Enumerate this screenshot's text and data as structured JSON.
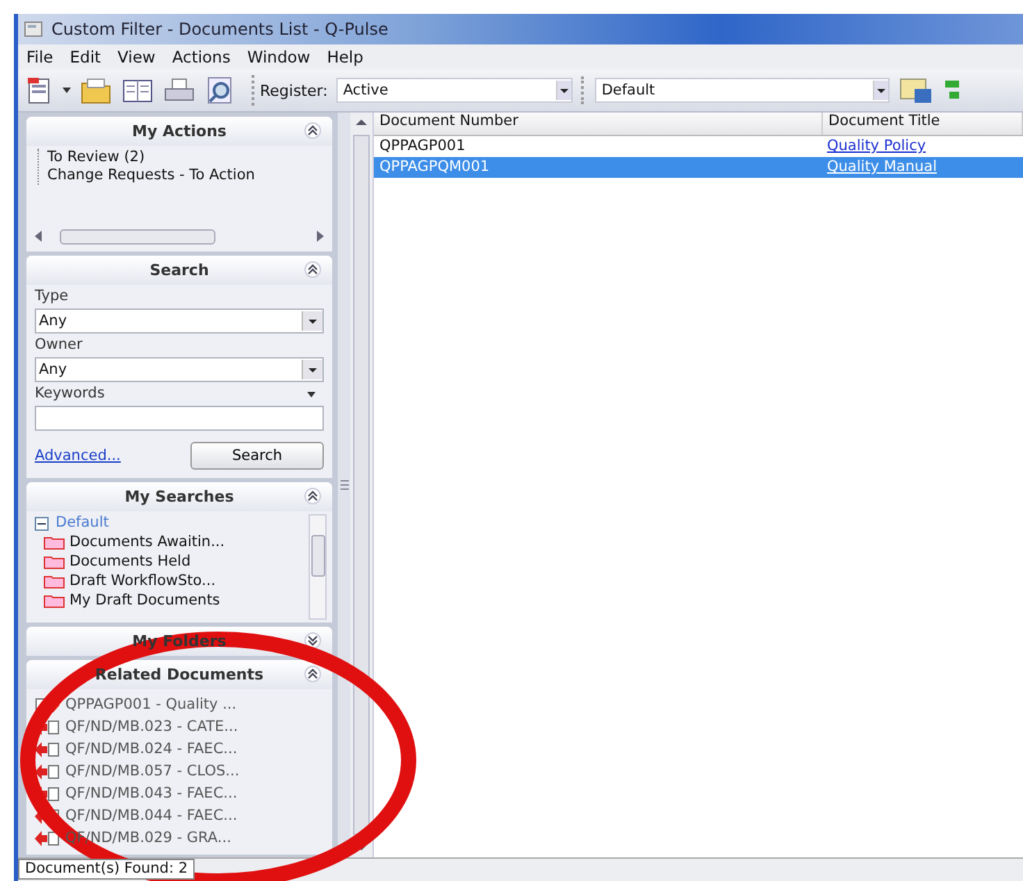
{
  "window": {
    "title": "Custom Filter - Documents List - Q-Pulse"
  },
  "menu": [
    "File",
    "Edit",
    "View",
    "Actions",
    "Window",
    "Help"
  ],
  "toolbar": {
    "register_label": "Register:",
    "register_value": "Active",
    "view_value": "Default"
  },
  "panels": [
    {
      "kind": "actions",
      "title": "My Actions",
      "expanded": true,
      "items": [
        "To Review (2)",
        "Change Requests - To Action"
      ]
    },
    {
      "kind": "search",
      "title": "Search",
      "expanded": true,
      "type_label": "Type",
      "type_value": "Any",
      "owner_label": "Owner",
      "owner_value": "Any",
      "keywords_label": "Keywords",
      "advanced_link": "Advanced...",
      "search_button": "Search"
    },
    {
      "kind": "searches",
      "title": "My Searches",
      "expanded": true,
      "root": {
        "label": "Default",
        "expanded": true,
        "children": [
          "Documents Awaitin...",
          "Documents Held",
          "Draft WorkflowSto...",
          "My Draft Documents"
        ]
      }
    },
    {
      "kind": "folders",
      "title": "My Folders",
      "expanded": false
    },
    {
      "kind": "related",
      "title": "Related Documents",
      "expanded": true,
      "items": [
        {
          "label": "QPPAGP001 - Quality ...",
          "kind": "parent"
        },
        {
          "label": "QF/ND/MB.023 - CATE...",
          "kind": "child"
        },
        {
          "label": "QF/ND/MB.024 - FAEC...",
          "kind": "child"
        },
        {
          "label": "QF/ND/MB.057 - CLOS...",
          "kind": "child"
        },
        {
          "label": "QF/ND/MB.043 - FAEC...",
          "kind": "child"
        },
        {
          "label": "QF/ND/MB.044 - FAEC...",
          "kind": "child"
        },
        {
          "label": "QF/ND/MB.029 - GRA...",
          "kind": "child"
        }
      ]
    }
  ],
  "table": {
    "columns": [
      "Document Number",
      "Document Title"
    ],
    "rows": [
      {
        "cells": [
          "QPPAGP001",
          "Quality Policy"
        ],
        "selected": false
      },
      {
        "cells": [
          "QPPAGPQM001",
          "Quality Manual"
        ],
        "selected": true
      }
    ]
  },
  "status_bar": "Document(s) Found: 2"
}
